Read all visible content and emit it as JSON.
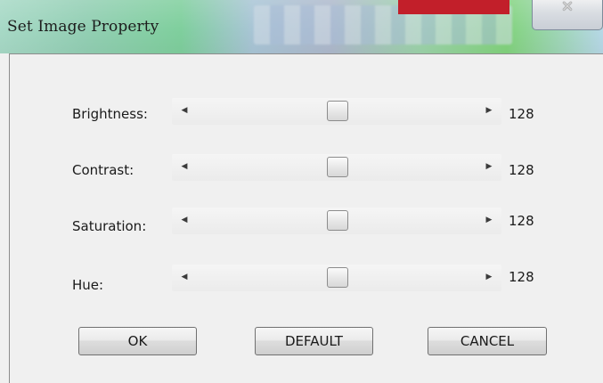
{
  "window": {
    "title": "Set Image Property",
    "accent_color": "#c21f2a",
    "close_icon": "close-icon"
  },
  "sliders": [
    {
      "label": "Brightness:",
      "value": "128",
      "value_num": 128,
      "min": 0,
      "max": 255,
      "left_arrow": "◀",
      "right_arrow": "▶"
    },
    {
      "label": "Contrast:",
      "value": "128",
      "value_num": 128,
      "min": 0,
      "max": 255,
      "left_arrow": "◀",
      "right_arrow": "▶"
    },
    {
      "label": "Saturation:",
      "value": "128",
      "value_num": 128,
      "min": 0,
      "max": 255,
      "left_arrow": "◀",
      "right_arrow": "▶"
    },
    {
      "label": "Hue:",
      "value": "128",
      "value_num": 128,
      "min": 0,
      "max": 255,
      "left_arrow": "◀",
      "right_arrow": "▶"
    }
  ],
  "buttons": {
    "ok_label": "OK",
    "default_label": "DEFAULT",
    "cancel_label": "CANCEL"
  }
}
